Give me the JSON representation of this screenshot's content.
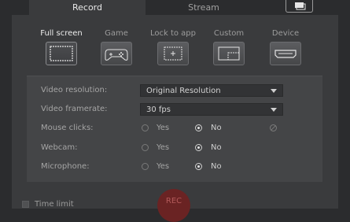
{
  "tabs": [
    {
      "label": "Record",
      "active": true
    },
    {
      "label": "Stream",
      "active": false
    }
  ],
  "header": {
    "screen_toggle_icon": "screen-toggle-icon"
  },
  "capture_modes": [
    {
      "label": "Full screen",
      "icon": "fullscreen-icon",
      "active": true
    },
    {
      "label": "Game",
      "icon": "gamepad-icon",
      "active": false
    },
    {
      "label": "Lock to app",
      "icon": "lock-to-app-icon",
      "active": false
    },
    {
      "label": "Custom",
      "icon": "custom-region-icon",
      "active": false
    },
    {
      "label": "Device",
      "icon": "hdmi-device-icon",
      "active": false
    }
  ],
  "settings": {
    "video_resolution": {
      "label": "Video resolution:",
      "value": "Original Resolution"
    },
    "video_framerate": {
      "label": "Video framerate:",
      "value": "30 fps"
    },
    "mouse_clicks": {
      "label": "Mouse clicks:",
      "options": [
        "Yes",
        "No"
      ],
      "selected": "No"
    },
    "webcam": {
      "label": "Webcam:",
      "options": [
        "Yes",
        "No"
      ],
      "selected": "No"
    },
    "microphone": {
      "label": "Microphone:",
      "options": [
        "Yes",
        "No"
      ],
      "selected": "No"
    }
  },
  "footer": {
    "time_limit_label": "Time limit",
    "rec_label": "REC"
  },
  "colors": {
    "background": "#2b2c2e",
    "panel": "#3a3b3d",
    "settings_panel": "#444547",
    "rec_button": "#6a2323"
  }
}
